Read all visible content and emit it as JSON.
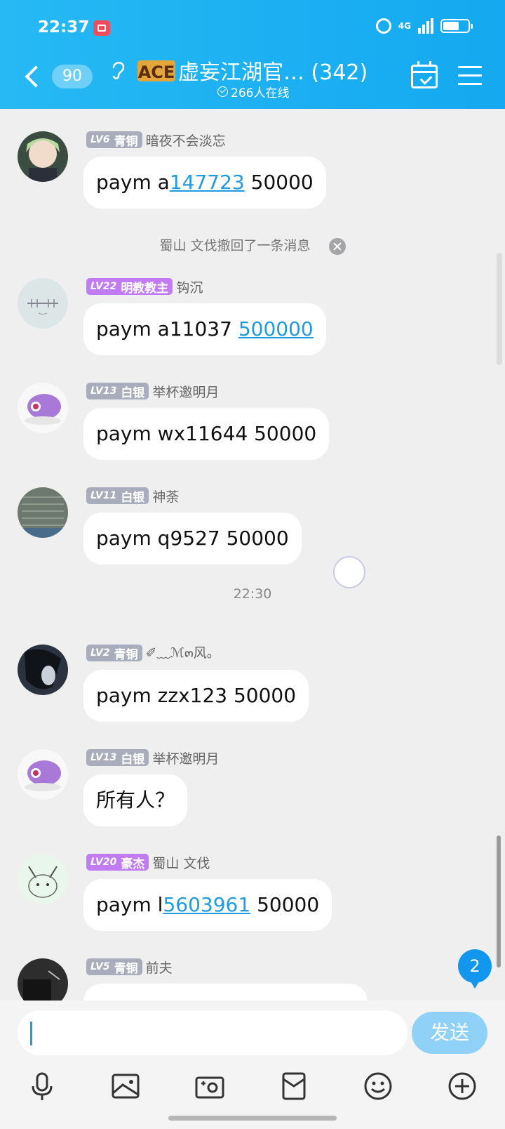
{
  "status_bar": {
    "time": "22:37",
    "network": "4G"
  },
  "header": {
    "unread": "90",
    "group_name": "虚妄江湖官…",
    "member_count": "(342)",
    "online": "266人在线",
    "logo_text": "ACE"
  },
  "messages": [
    {
      "level": "LV6",
      "rank": "青铜",
      "nick": "暗夜不会淡忘",
      "text_pre": "paym a",
      "link": "147723",
      "text_post": " 50000"
    },
    {
      "level": "LV22",
      "rank": "明教教主",
      "nick": "钩沉",
      "text_pre": "paym a11037 ",
      "link": "500000",
      "text_post": ""
    },
    {
      "level": "LV13",
      "rank": "白银",
      "nick": "举杯邀明月",
      "text_pre": "paym wx11644 50000",
      "link": "",
      "text_post": ""
    },
    {
      "level": "LV11",
      "rank": "白银",
      "nick": "神荼",
      "text_pre": "paym q9527 50000",
      "link": "",
      "text_post": ""
    },
    {
      "level": "LV2",
      "rank": "青铜",
      "nick": "✐﹏ℳ๓风。",
      "text_pre": "paym zzx123 50000",
      "link": "",
      "text_post": ""
    },
    {
      "level": "LV13",
      "rank": "白银",
      "nick": "举杯邀明月",
      "text_pre": "所有人？",
      "link": "",
      "text_post": ""
    },
    {
      "level": "LV20",
      "rank": "豪杰",
      "nick": "蜀山 文伐",
      "text_pre": "paym l",
      "link": "5603961",
      "text_post": " 50000"
    },
    {
      "level": "LV5",
      "rank": "青铜",
      "nick": "前夫"
    }
  ],
  "system_notice": "蜀山 文伐撤回了一条消息",
  "time_separator": "22:30",
  "new_message_count": "2",
  "input": {
    "placeholder": "",
    "send_label": "发送"
  },
  "colors": {
    "header": "#1ab0f2",
    "link": "#1f9ce0",
    "badge_grey": "#a9adbb",
    "badge_purple": "#c27cf3"
  }
}
